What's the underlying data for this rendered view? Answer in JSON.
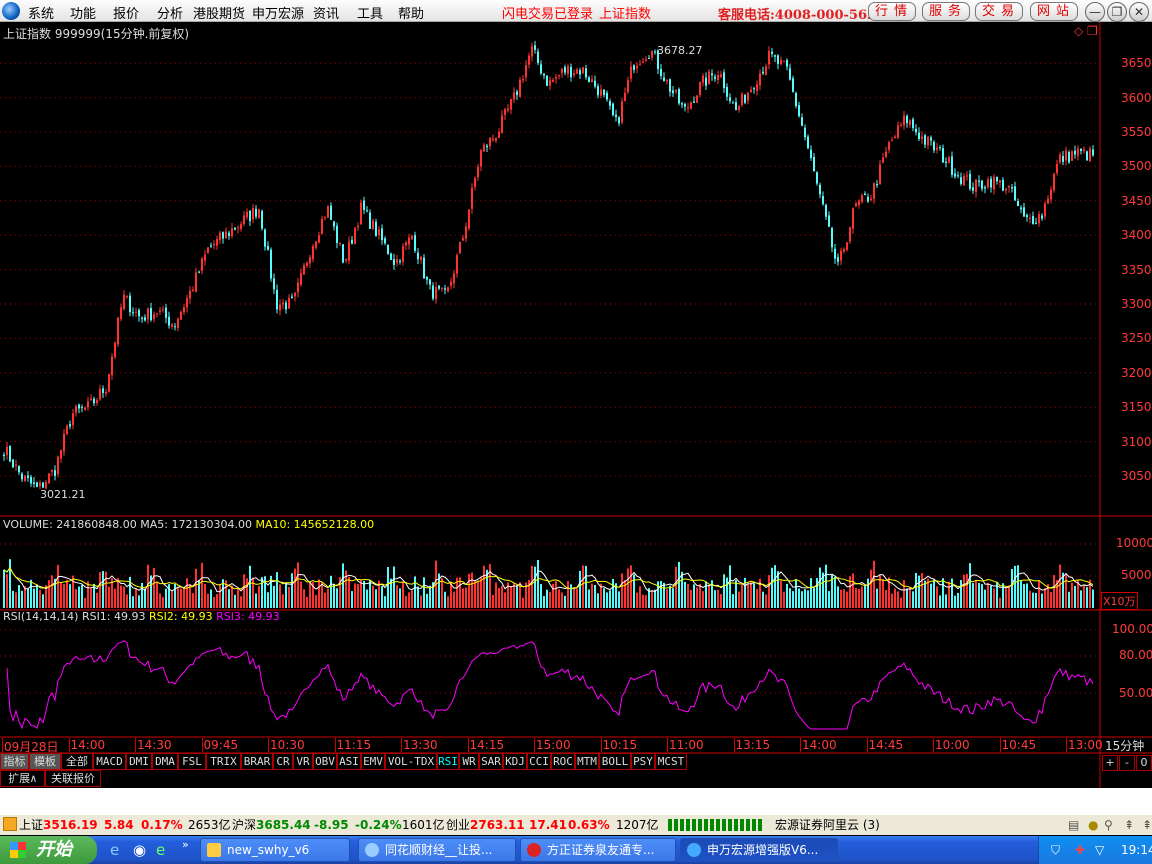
{
  "menubar": {
    "items": [
      "系统",
      "功能",
      "报价",
      "分析",
      "港股期货",
      "申万宏源",
      "资讯",
      "工具",
      "帮助"
    ],
    "status1": "闪电交易已登录",
    "status2": "上证指数",
    "hotline": "客服电话:4008-000-562",
    "pills": [
      "行情",
      "服务",
      "交易",
      "网站"
    ],
    "window_buttons": [
      "minimize",
      "restore",
      "close"
    ]
  },
  "chart": {
    "title": "上证指数 999999(15分钟.前复权)",
    "high_label": "3678.27",
    "low_label": "3021.21",
    "price_ticks": [
      "3650",
      "3600",
      "3550",
      "3500",
      "3450",
      "3400",
      "3350",
      "3300",
      "3250",
      "3200",
      "3150",
      "3100",
      "3050"
    ],
    "volume_header": {
      "volume": "VOLUME: 241860848.00",
      "ma5": "MA5: 172130304.00",
      "ma10": "MA10: 145652128.00"
    },
    "volume_ticks": [
      "10000",
      "5000"
    ],
    "volume_unit": "X10万",
    "rsi_header": {
      "params": "RSI(14,14,14)",
      "rsi1": "RSI1: 49.93",
      "rsi2": "RSI2: 49.93",
      "rsi3": "RSI3: 49.93"
    },
    "rsi_ticks": [
      "100.00",
      "80.00",
      "50.00"
    ],
    "time_labels": [
      "09月28日",
      "14:00",
      "14:30",
      "09:45",
      "10:30",
      "11:15",
      "13:30",
      "14:15",
      "15:00",
      "10:15",
      "11:00",
      "13:15",
      "14:00",
      "14:45",
      "10:00",
      "10:45",
      "13:00"
    ],
    "period": "15分钟",
    "zoom_buttons": [
      "+",
      "-",
      "0"
    ],
    "colors": {
      "up": "#ff3232",
      "down": "#54fcfc",
      "ma5": "#ffffff",
      "ma10": "#ffff00",
      "rsi": "#ff00ff",
      "axis": "#ff3b3b"
    }
  },
  "chart_data": {
    "type": "candlestick",
    "ylim": [
      3021.21,
      3678.27
    ],
    "closes_outline": [
      3090,
      3050,
      3030,
      3060,
      3140,
      3150,
      3180,
      3310,
      3280,
      3290,
      3270,
      3320,
      3380,
      3400,
      3420,
      3440,
      3300,
      3300,
      3380,
      3440,
      3360,
      3440,
      3400,
      3360,
      3400,
      3320,
      3310,
      3400,
      3520,
      3550,
      3600,
      3670,
      3620,
      3640,
      3640,
      3610,
      3560,
      3650,
      3670,
      3620,
      3580,
      3620,
      3640,
      3580,
      3620,
      3660,
      3640,
      3550,
      3450,
      3350,
      3440,
      3460,
      3530,
      3570,
      3540,
      3520,
      3490,
      3470,
      3480,
      3470,
      3420,
      3430,
      3510,
      3520,
      3516
    ]
  },
  "tabs": {
    "row1": [
      "指标",
      "模板",
      "全部",
      "MACD",
      "DMI",
      "DMA",
      "FSL",
      "TRIX",
      "BRAR",
      "CR",
      "VR",
      "OBV",
      "ASI",
      "EMV",
      "VOL-TDX",
      "RSI",
      "WR",
      "SAR",
      "KDJ",
      "CCI",
      "ROC",
      "MTM",
      "BOLL",
      "PSY",
      "MCST"
    ],
    "active": "RSI",
    "row2": [
      "扩展∧",
      "关联报价"
    ]
  },
  "status": {
    "sh_label": "上证",
    "sh_val": "3516.19",
    "sh_chg": "5.84",
    "sh_pct": "0.17%",
    "sh_amt": "2653亿",
    "hs_label": "沪深",
    "hs_val": "3685.44",
    "hs_chg": "-8.95",
    "hs_pct": "-0.24%",
    "hs_amt": "1601亿",
    "cy_label": "创业",
    "cy_val": "2763.11",
    "cy_chg": "17.41",
    "cy_pct": "0.63%",
    "cy_amt": "1207亿",
    "server": "宏源证券阿里云 (3)"
  },
  "taskbar": {
    "start": "开始",
    "tasks": [
      "new_swhy_v6",
      "同花顺财经__让投...",
      "方正证券泉友通专...",
      "申万宏源增强版V6..."
    ],
    "clock": "19:14"
  }
}
